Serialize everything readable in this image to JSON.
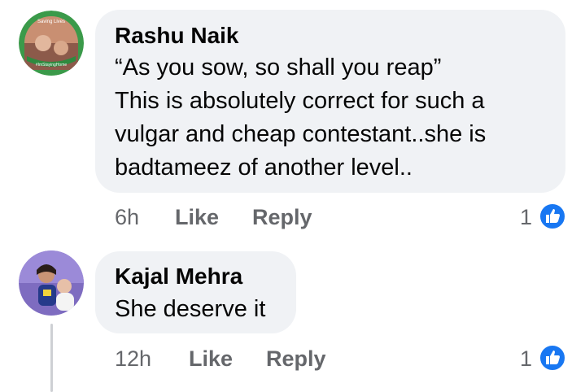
{
  "comments": [
    {
      "author": "Rashu Naik",
      "avatar_badge_top": "Saving Lives",
      "avatar_badge_bottom": "#ImStayingHome",
      "lines": [
        "“As you sow, so shall you reap”",
        "This is absolutely correct for such a",
        "vulgar and cheap contestant..she is",
        "badtameez of another level.."
      ],
      "time": "6h",
      "like_label": "Like",
      "reply_label": "Reply",
      "reaction_count": "1"
    },
    {
      "author": "Kajal Mehra",
      "lines": [
        "She deserve it"
      ],
      "time": "12h",
      "like_label": "Like",
      "reply_label": "Reply",
      "reaction_count": "1"
    }
  ],
  "colors": {
    "bubble": "#f0f2f5",
    "meta": "#65676b",
    "like_blue": "#1877f2",
    "frame_green": "#3b9a4a"
  },
  "icons": [
    "profile-frame-avatar",
    "thumbs-up-icon",
    "child-photo-avatar"
  ]
}
